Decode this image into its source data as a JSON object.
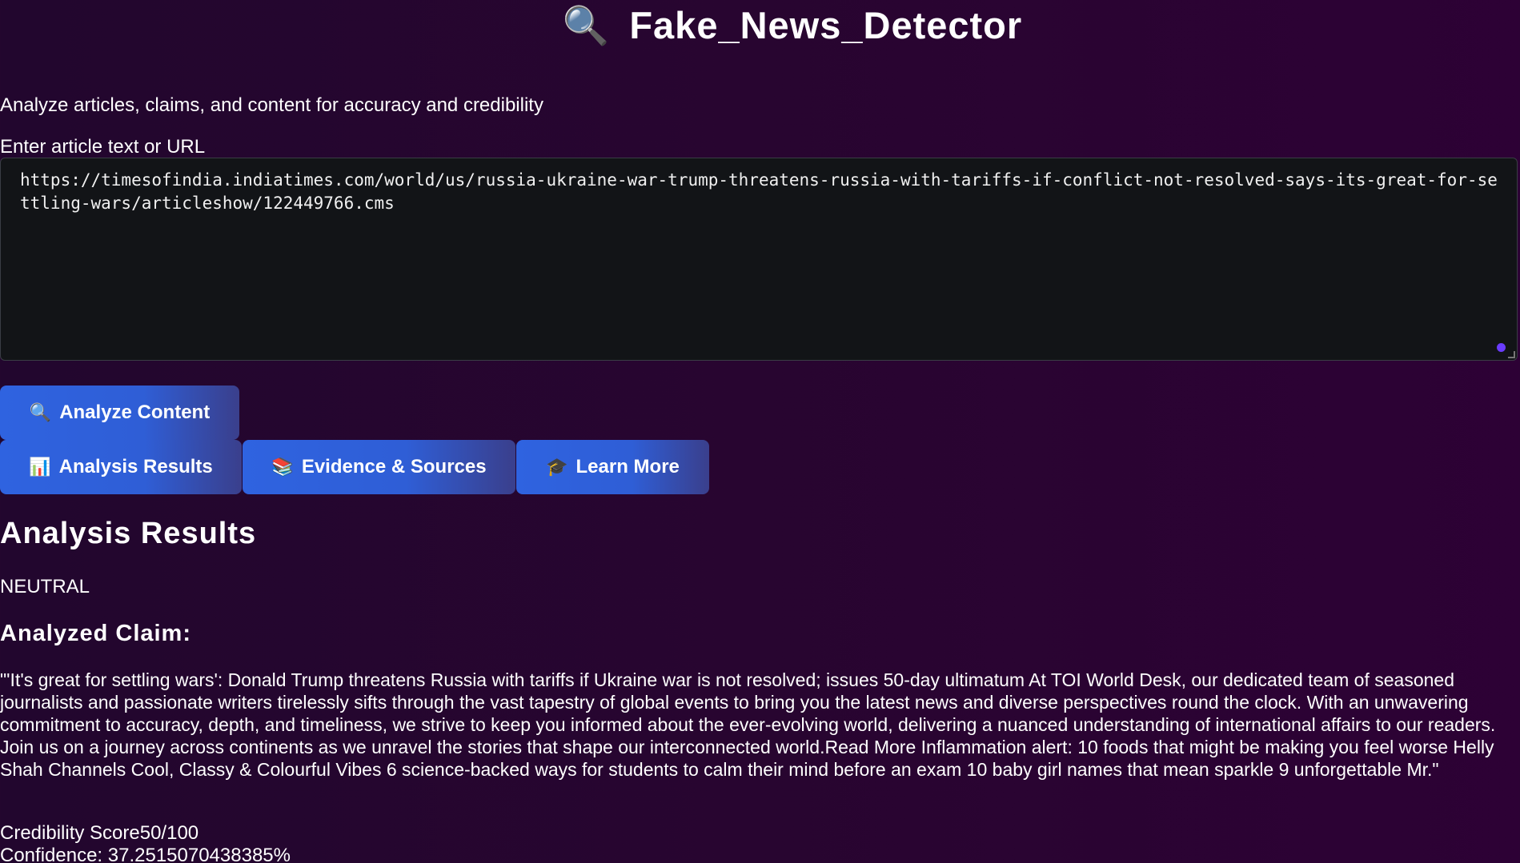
{
  "header": {
    "emoji": "🔍",
    "title": "Fake_News_Detector",
    "subtitle": "Analyze articles, claims, and content for accuracy and credibility"
  },
  "input": {
    "label": "Enter article text or URL",
    "value": "https://timesofindia.indiatimes.com/world/us/russia-ukraine-war-trump-threatens-russia-with-tariffs-if-conflict-not-resolved-says-its-great-for-settling-wars/articleshow/122449766.cms"
  },
  "buttons": {
    "analyze": {
      "icon": "🔍",
      "icon_name": "magnifier-icon",
      "label": "Analyze Content"
    },
    "results": {
      "icon": "📊",
      "icon_name": "bar-chart-icon",
      "label": "Analysis Results"
    },
    "evidence": {
      "icon": "📚",
      "icon_name": "books-icon",
      "label": "Evidence & Sources"
    },
    "learn": {
      "icon": "🎓",
      "icon_name": "graduation-cap-icon",
      "label": "Learn More"
    }
  },
  "results": {
    "heading": "Analysis Results",
    "verdict": "NEUTRAL",
    "claim_heading": "Analyzed Claim:",
    "claim_text": "\"'It's great for settling wars': Donald Trump threatens Russia with tariffs if Ukraine war is not resolved; issues 50-day ultimatum At TOI World Desk, our dedicated team of seasoned journalists and passionate writers tirelessly sifts through the vast tapestry of global events to bring you the latest news and diverse perspectives round the clock. With an unwavering commitment to accuracy, depth, and timeliness, we strive to keep you informed about the ever-evolving world, delivering a nuanced understanding of international affairs to our readers. Join us on a journey across continents as we unravel the stories that shape our interconnected world.Read More Inflammation alert: 10 foods that might be making you feel worse Helly Shah Channels Cool, Classy & Colourful Vibes 6 science-backed ways for students to calm their mind before an exam 10 baby girl names that mean sparkle 9 unforgettable Mr.\"",
    "credibility_label": "Credibility Score",
    "credibility_value": "50/100",
    "confidence": "Confidence: 37.2515070438385%"
  },
  "colors": {
    "background": "#2a0432",
    "button": "#2f63e0",
    "textarea_bg": "#121417"
  }
}
